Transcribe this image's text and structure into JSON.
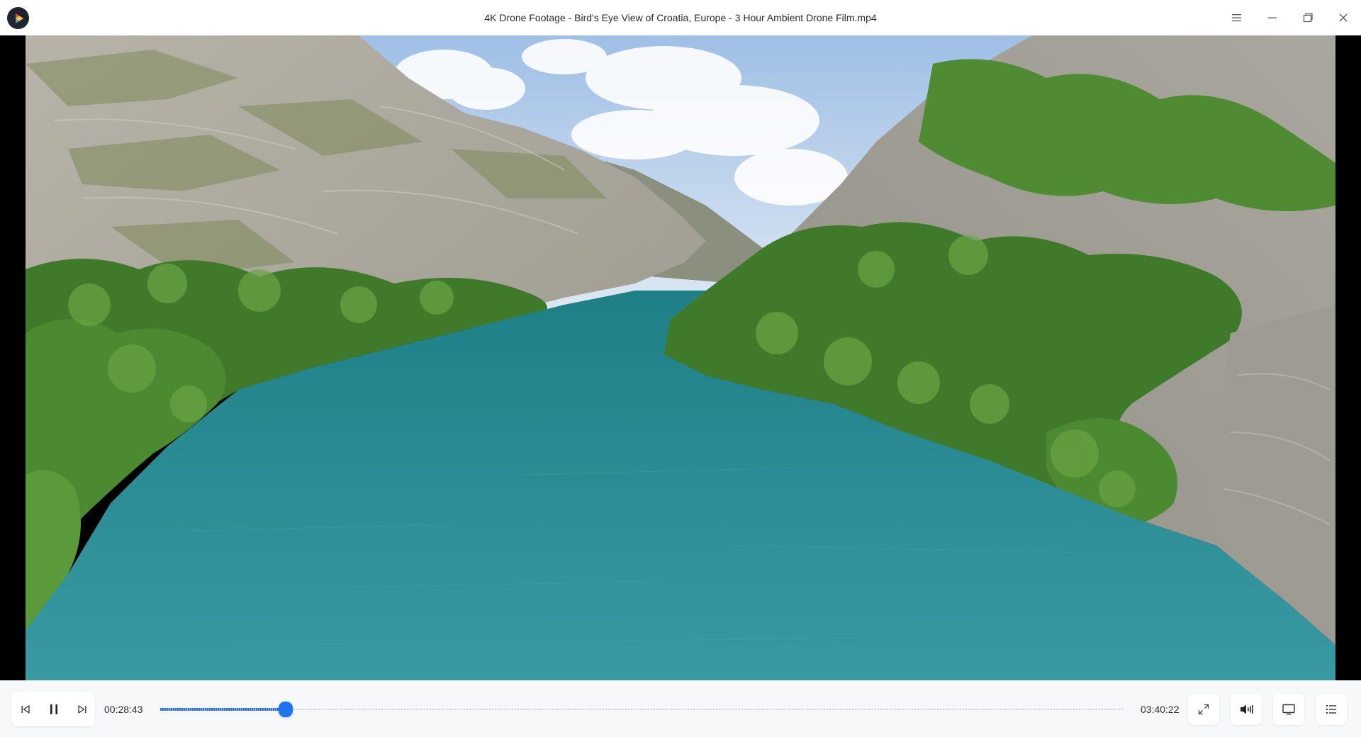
{
  "window": {
    "title": "4K Drone Footage - Bird's Eye View of Croatia, Europe - 3 Hour Ambient Drone Film.mp4"
  },
  "player": {
    "current_time": "00:28:43",
    "total_time": "03:40:22",
    "progress_fraction": 0.1304
  },
  "icons": {
    "logo": "player-logo-icon",
    "menu": "hamburger-menu-icon",
    "minimize": "minimize-icon",
    "restore": "restore-icon",
    "close": "close-icon",
    "prev": "skip-previous-icon",
    "pause": "pause-icon",
    "next": "skip-next-icon",
    "fullscreen": "fullscreen-icon",
    "volume": "volume-icon",
    "screen": "screen-cast-icon",
    "playlist": "playlist-icon"
  },
  "colors": {
    "accent": "#1f74ef",
    "progress_fill": "#2d6fe0",
    "water": "#2f8c95",
    "sky": "#a9c7e8"
  }
}
